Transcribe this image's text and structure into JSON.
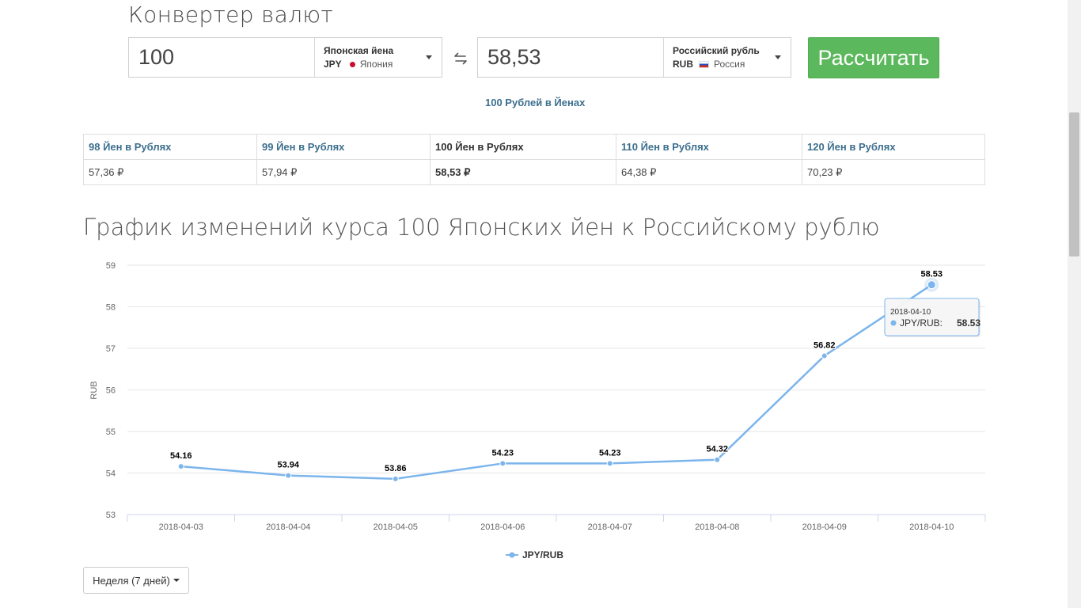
{
  "header": {
    "title": "Конвертер валют"
  },
  "converter": {
    "from": {
      "amount": "100",
      "currency_name": "Японская йена",
      "currency_code": "JPY",
      "country": "Япония",
      "flag_color": "#c8102e"
    },
    "to": {
      "amount": "58,53",
      "currency_name": "Российский рубль",
      "currency_code": "RUB",
      "country": "Россия"
    },
    "calculate_label": "Рассчитать",
    "reverse_link": "100 Рублей в Йенах",
    "accent_color": "#5cb85c"
  },
  "rates_table": {
    "headers": [
      "98 Йен в Рублях",
      "99 Йен в Рублях",
      "100 Йен в Рублях",
      "110 Йен в Рублях",
      "120 Йен в Рублях"
    ],
    "values": [
      "57,36 ₽",
      "57,94 ₽",
      "58,53 ₽",
      "64,38 ₽",
      "70,23 ₽"
    ],
    "active_index": 2
  },
  "chart_section": {
    "title": "График изменений курса 100 Японских йен к Российскому рублю",
    "range_label": "Неделя (7 дней)"
  },
  "chart_data": {
    "type": "line",
    "title": "",
    "xlabel": "",
    "ylabel": "RUB",
    "ylim": [
      53,
      59
    ],
    "y_ticks": [
      53,
      54,
      55,
      56,
      57,
      58,
      59
    ],
    "x": [
      "2018-04-03",
      "2018-04-04",
      "2018-04-05",
      "2018-04-06",
      "2018-04-07",
      "2018-04-08",
      "2018-04-09",
      "2018-04-10"
    ],
    "series": [
      {
        "name": "JPY/RUB",
        "color": "#7cb5ec",
        "values": [
          54.16,
          53.94,
          53.86,
          54.23,
          54.23,
          54.32,
          56.82,
          58.53
        ],
        "labels": [
          "54.16",
          "53.94",
          "53.86",
          "54.23",
          "54.23",
          "54.32",
          "56.82",
          "58.53"
        ]
      }
    ],
    "legend_position": "bottom-center",
    "grid": true,
    "tooltip": {
      "date": "2018-04-10",
      "series": "JPY/RUB",
      "value": "58.53",
      "point_index": 7
    }
  }
}
